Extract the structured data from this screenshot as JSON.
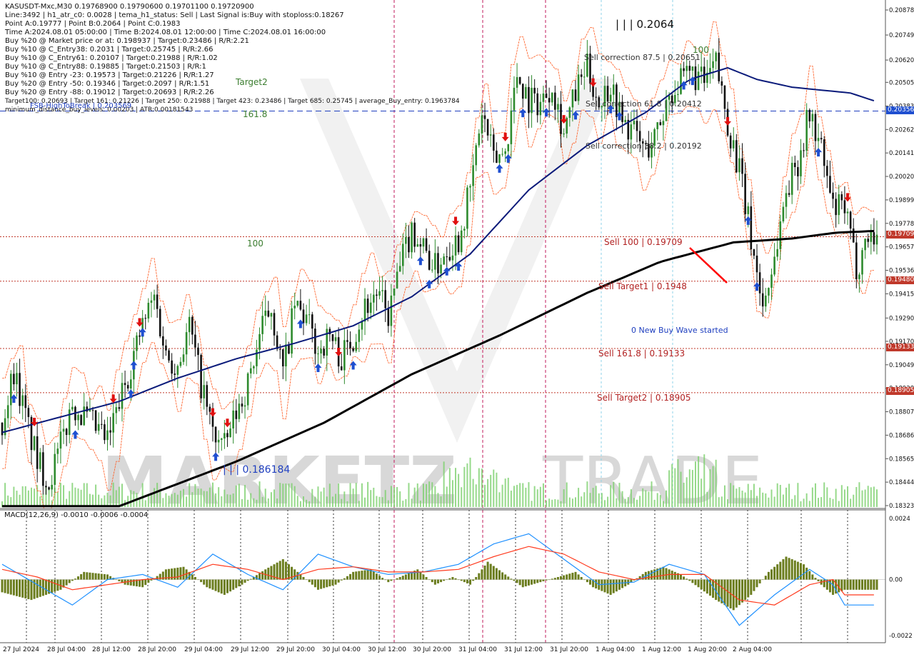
{
  "header": {
    "lines": [
      "KASUSDT-Mxc,M30  0.19768900 0.19790600 0.19701100 0.19720900",
      "Line:3492  |  h1_atr_c0: 0.0028  |  tema_h1_status: Sell  |  Last Signal is:Buy with stoploss:0.18267",
      "Point A:0.19777  |  Point B:0.2064  |  Point C:0.1983",
      "Time A:2024.08.01 05:00:00  |  Time B:2024.08.01 12:00:00  |  Time C:2024.08.01 16:00:00",
      "Buy %20 @ Market price or at: 0.198937  |  Target:0.23486  |  R/R:2.21",
      "Buy %10 @ C_Entry38: 0.2031  |  Target:0.25745  |  R/R:2.66",
      "Buy %10 @ C_Entry61: 0.20107  |  Target:0.21988  |  R/R:1.02",
      "Buy %10 @ C_Entry88: 0.19885  |  Target:0.21503  |  R/R:1",
      "Buy %10 @ Entry -23: 0.19573  |  Target:0.21226  |  R/R:1.27",
      "Buy %20 @ Entry -50: 0.19346  |  Target:0.2097  |  R/R:1.51",
      "Buy %20 @ Entry -88: 0.19012  |  Target:0.20693  |  R/R:2.26",
      "Target100: 0.20693  |  Target 161: 0.21226  |  Target 250: 0.21988  |  Target 423: 0.23486  |  Target 685: 0.25745  |  average_Buy_entry: 0.1963784",
      "minimum_distance_buy_levels: 0.00203  |  ATR:0.00181543"
    ]
  },
  "labels": {
    "target2": "Target2",
    "fib_161": "161.8",
    "fib_100_left": "100",
    "fib_100_right": "100",
    "fsb_high": "FSB-HighToBreak | 0.203569",
    "high_point": "| | | 0.2064",
    "low_point": "| | | 0.186184",
    "sell_corr_88": "Sell correction 87.5 | 0.20651",
    "sell_corr_61": "Sell correction 61.8 | 0.20412",
    "sell_corr_38": "Sell correction 38.2 | 0.20192",
    "sell_100": "Sell 100 | 0.19709",
    "sell_target1": "Sell Target1 | 0.1948",
    "new_wave": "0 New Buy Wave started",
    "sell_161": "Sell 161.8 | 0.19133",
    "sell_target2": "Sell Target2 | 0.18905",
    "macd_title": "MACD(12,26,9) -0.0010 -0.0006 -0.0004",
    "watermark_left": "MARKETZ",
    "watermark_right": "TRADE"
  },
  "chart_data": {
    "type": "candlestick",
    "symbol": "KASUSDT-Mxc",
    "timeframe": "M30",
    "ylim": [
      0.18323,
      0.20878
    ],
    "price_ticks": [
      "0.20878",
      "0.20749",
      "0.20620",
      "0.20505",
      "0.20383",
      "0.20262",
      "0.20141",
      "0.20020",
      "0.19899",
      "0.19778",
      "0.19657",
      "0.19536",
      "0.19415",
      "0.19290",
      "0.19170",
      "0.19049",
      "0.18928",
      "0.18807",
      "0.18686",
      "0.18565",
      "0.18444",
      "0.18323"
    ],
    "time_labels": [
      "27 Jul 2024",
      "28 Jul 04:00",
      "28 Jul 12:00",
      "28 Jul 20:00",
      "29 Jul 04:00",
      "29 Jul 12:00",
      "29 Jul 20:00",
      "30 Jul 04:00",
      "30 Jul 12:00",
      "30 Jul 20:00",
      "31 Jul 04:00",
      "31 Jul 12:00",
      "31 Jul 20:00",
      "1 Aug 04:00",
      "1 Aug 12:00",
      "1 Aug 20:00",
      "2 Aug 04:00"
    ],
    "price_tags": [
      {
        "value": "0.20356",
        "color": "#1f4fd0"
      },
      {
        "value": "0.19709",
        "color": "#c0392b"
      },
      {
        "value": "0.19480",
        "color": "#c0392b"
      },
      {
        "value": "0.19133",
        "color": "#c0392b"
      },
      {
        "value": "0.18905",
        "color": "#c0392b"
      }
    ],
    "horizontal_levels": [
      {
        "name": "FSB-HighToBreak",
        "value": 0.203569,
        "color": "#1f3fbf",
        "style": "dashed"
      },
      {
        "name": "Sell 100",
        "value": 0.19709,
        "color": "#c0392b",
        "style": "dotted"
      },
      {
        "name": "Sell Target1",
        "value": 0.1948,
        "color": "#c0392b",
        "style": "dotted"
      },
      {
        "name": "Sell 161.8",
        "value": 0.19133,
        "color": "#c0392b",
        "style": "dotted"
      },
      {
        "name": "Sell Target2",
        "value": 0.18905,
        "color": "#c0392b",
        "style": "dotted"
      }
    ],
    "close_path": [
      [
        0,
        0.1875
      ],
      [
        4,
        0.1902
      ],
      [
        8,
        0.1878
      ],
      [
        12,
        0.1855
      ],
      [
        16,
        0.1845
      ],
      [
        20,
        0.1863
      ],
      [
        24,
        0.1885
      ],
      [
        28,
        0.1878
      ],
      [
        32,
        0.1872
      ],
      [
        36,
        0.1865
      ],
      [
        40,
        0.1885
      ],
      [
        44,
        0.1905
      ],
      [
        48,
        0.1925
      ],
      [
        52,
        0.194
      ],
      [
        56,
        0.191
      ],
      [
        60,
        0.1905
      ],
      [
        64,
        0.1925
      ],
      [
        68,
        0.1895
      ],
      [
        72,
        0.187
      ],
      [
        76,
        0.1862
      ],
      [
        80,
        0.188
      ],
      [
        84,
        0.1895
      ],
      [
        88,
        0.192
      ],
      [
        92,
        0.1935
      ],
      [
        96,
        0.19
      ],
      [
        100,
        0.1935
      ],
      [
        104,
        0.1928
      ],
      [
        108,
        0.1912
      ],
      [
        112,
        0.192
      ],
      [
        116,
        0.1908
      ],
      [
        120,
        0.192
      ],
      [
        124,
        0.1935
      ],
      [
        128,
        0.1942
      ],
      [
        132,
        0.193
      ],
      [
        136,
        0.1955
      ],
      [
        140,
        0.1975
      ],
      [
        144,
        0.1965
      ],
      [
        148,
        0.1955
      ],
      [
        152,
        0.1965
      ],
      [
        156,
        0.197
      ],
      [
        160,
        0.1995
      ],
      [
        164,
        0.2035
      ],
      [
        168,
        0.201
      ],
      [
        172,
        0.2015
      ],
      [
        176,
        0.2055
      ],
      [
        180,
        0.2042
      ],
      [
        184,
        0.204
      ],
      [
        188,
        0.205
      ],
      [
        192,
        0.2025
      ],
      [
        196,
        0.2045
      ],
      [
        200,
        0.2058
      ],
      [
        204,
        0.204
      ],
      [
        208,
        0.205
      ],
      [
        212,
        0.203
      ],
      [
        216,
        0.2025
      ],
      [
        220,
        0.2015
      ],
      [
        224,
        0.2025
      ],
      [
        228,
        0.2045
      ],
      [
        232,
        0.205
      ],
      [
        236,
        0.2055
      ],
      [
        240,
        0.205
      ],
      [
        244,
        0.206
      ],
      [
        248,
        0.203
      ],
      [
        252,
        0.2005
      ],
      [
        256,
        0.197
      ],
      [
        260,
        0.1935
      ],
      [
        264,
        0.196
      ],
      [
        268,
        0.1995
      ],
      [
        272,
        0.201
      ],
      [
        276,
        0.2035
      ],
      [
        280,
        0.2015
      ],
      [
        284,
        0.1985
      ],
      [
        288,
        0.1985
      ],
      [
        292,
        0.1955
      ],
      [
        296,
        0.1972
      ]
    ],
    "sma_blue": [
      [
        0,
        0.187
      ],
      [
        20,
        0.1878
      ],
      [
        40,
        0.1886
      ],
      [
        60,
        0.1898
      ],
      [
        80,
        0.1908
      ],
      [
        100,
        0.1916
      ],
      [
        120,
        0.1925
      ],
      [
        140,
        0.194
      ],
      [
        160,
        0.1962
      ],
      [
        180,
        0.1995
      ],
      [
        200,
        0.2018
      ],
      [
        220,
        0.2035
      ],
      [
        235,
        0.2052
      ],
      [
        248,
        0.2058
      ],
      [
        258,
        0.2052
      ],
      [
        270,
        0.2048
      ],
      [
        290,
        0.2045
      ],
      [
        300,
        0.204
      ]
    ],
    "sma_black": [
      [
        0,
        0.1832
      ],
      [
        40,
        0.1832
      ],
      [
        80,
        0.1855
      ],
      [
        110,
        0.1875
      ],
      [
        140,
        0.19
      ],
      [
        170,
        0.192
      ],
      [
        200,
        0.1942
      ],
      [
        225,
        0.1958
      ],
      [
        250,
        0.1968
      ],
      [
        270,
        0.197
      ],
      [
        285,
        0.1973
      ],
      [
        300,
        0.1974
      ]
    ],
    "macd": {
      "params": "12,26,9",
      "value": -0.001,
      "signal": -0.0006,
      "histogram": -0.0004,
      "ylim": [
        -0.0022,
        0.0024
      ],
      "ticks": [
        "0.0024",
        "0.00",
        "-0.0022"
      ],
      "hist_path": [
        [
          0,
          -0.0005
        ],
        [
          10,
          -0.0008
        ],
        [
          20,
          -0.0004
        ],
        [
          28,
          0.0003
        ],
        [
          36,
          0.0002
        ],
        [
          42,
          -0.0002
        ],
        [
          48,
          -0.0003
        ],
        [
          56,
          0.0004
        ],
        [
          62,
          0.0005
        ],
        [
          70,
          -0.0003
        ],
        [
          76,
          -0.0006
        ],
        [
          82,
          -0.0002
        ],
        [
          90,
          0.0004
        ],
        [
          96,
          0.0008
        ],
        [
          102,
          0.0002
        ],
        [
          108,
          -0.0004
        ],
        [
          114,
          -0.0002
        ],
        [
          120,
          0.0003
        ],
        [
          126,
          0.0004
        ],
        [
          132,
          -0.0001
        ],
        [
          138,
          0.0002
        ],
        [
          142,
          0.0004
        ],
        [
          148,
          -0.0002
        ],
        [
          154,
          0.0001
        ],
        [
          160,
          -0.0002
        ],
        [
          166,
          0.0007
        ],
        [
          172,
          0.0002
        ],
        [
          178,
          -0.0003
        ],
        [
          184,
          -0.0001
        ],
        [
          190,
          0.0001
        ],
        [
          196,
          0.0003
        ],
        [
          202,
          -0.0003
        ],
        [
          208,
          -0.0006
        ],
        [
          214,
          -0.0002
        ],
        [
          220,
          0.0003
        ],
        [
          226,
          0.0005
        ],
        [
          232,
          0.0002
        ],
        [
          238,
          -0.0003
        ],
        [
          244,
          -0.0008
        ],
        [
          250,
          -0.0012
        ],
        [
          256,
          -0.0006
        ],
        [
          262,
          0.0003
        ],
        [
          268,
          0.0009
        ],
        [
          274,
          0.0006
        ],
        [
          280,
          -0.0002
        ],
        [
          284,
          -0.0006
        ],
        [
          288,
          -0.0004
        ]
      ],
      "macd_path": [
        [
          0,
          0.0006
        ],
        [
          12,
          -0.0002
        ],
        [
          24,
          -0.001
        ],
        [
          36,
          0.0
        ],
        [
          48,
          0.0002
        ],
        [
          60,
          -0.0003
        ],
        [
          72,
          0.001
        ],
        [
          84,
          0.0002
        ],
        [
          96,
          -0.0004
        ],
        [
          108,
          0.001
        ],
        [
          120,
          0.0005
        ],
        [
          132,
          0.0002
        ],
        [
          144,
          0.0003
        ],
        [
          156,
          0.0006
        ],
        [
          168,
          0.0014
        ],
        [
          180,
          0.0018
        ],
        [
          192,
          0.0008
        ],
        [
          204,
          -0.0002
        ],
        [
          216,
          -0.0001
        ],
        [
          228,
          0.0006
        ],
        [
          240,
          0.0002
        ],
        [
          252,
          -0.0018
        ],
        [
          264,
          -0.0006
        ],
        [
          276,
          0.0004
        ],
        [
          284,
          -0.0002
        ],
        [
          288,
          -0.001
        ]
      ],
      "signal_path": [
        [
          0,
          0.0004
        ],
        [
          12,
          0.0001
        ],
        [
          24,
          -0.0004
        ],
        [
          36,
          -0.0002
        ],
        [
          48,
          0.0
        ],
        [
          60,
          0.0001
        ],
        [
          72,
          0.0006
        ],
        [
          84,
          0.0004
        ],
        [
          96,
          0.0
        ],
        [
          108,
          0.0004
        ],
        [
          120,
          0.0005
        ],
        [
          132,
          0.0003
        ],
        [
          144,
          0.0003
        ],
        [
          156,
          0.0004
        ],
        [
          168,
          0.0009
        ],
        [
          180,
          0.0013
        ],
        [
          192,
          0.001
        ],
        [
          204,
          0.0003
        ],
        [
          216,
          0.0
        ],
        [
          228,
          0.0002
        ],
        [
          240,
          0.0002
        ],
        [
          252,
          -0.0008
        ],
        [
          264,
          -0.001
        ],
        [
          276,
          -0.0002
        ],
        [
          284,
          0.0
        ],
        [
          288,
          -0.0006
        ]
      ]
    }
  }
}
